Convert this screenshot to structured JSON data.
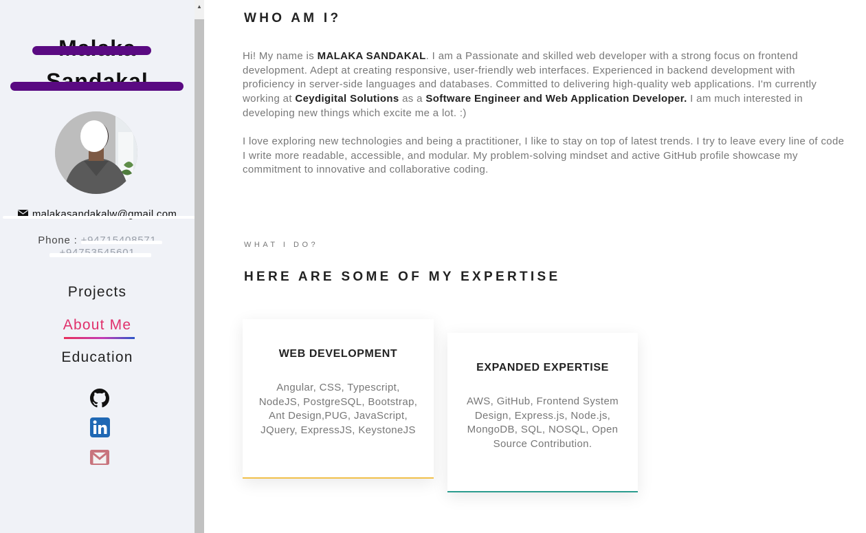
{
  "sidebar": {
    "name_line1": "Malaka",
    "name_line2": "Sandakal",
    "email": "malakasandakalw@gmail.com",
    "phone_label": "Phone :",
    "phone1": "+94715408571",
    "phone2": "+94753545601",
    "nav": {
      "projects": "Projects",
      "about": "About Me",
      "education": "Education"
    },
    "colors": {
      "active_nav": "#e0306b",
      "redaction": "#5a0a82",
      "background": "#f0f2f7"
    }
  },
  "main": {
    "who_title": "WHO AM I?",
    "about": {
      "p1_a": "Hi! My name is ",
      "p1_name": "MALAKA SANDAKAL",
      "p1_b": ". I am a Passionate and skilled web developer with a strong focus on frontend development. Adept at creating responsive, user-friendly web interfaces. Experienced in backend development with proficiency in server-side languages and databases. Committed to delivering high-quality web applications. I'm currently working at ",
      "p1_company": "Ceydigital Solutions",
      "p1_c": " as a ",
      "p1_role": "Software Engineer and Web Application Developer.",
      "p1_d": " I am much interested in developing new things which excite me a lot. :)",
      "p2": "I love exploring new technologies and being a practitioner, I like to stay on top of latest trends. I try to leave every line of code I write more readable, accessible, and modular. My problem-solving mindset and active GitHub profile showcase my commitment to innovative and collaborative coding."
    },
    "what_label": "WHAT I DO?",
    "expertise_title": "HERE ARE SOME OF MY EXPERTISE",
    "cards": [
      {
        "title": "WEB DEVELOPMENT",
        "body": "Angular, CSS, Typescript, NodeJS, PostgreSQL, Bootstrap, Ant Design,PUG, JavaScript, JQuery, ExpressJS, KeystoneJS",
        "accent": "#f1c04a"
      },
      {
        "title": "EXPANDED EXPERTISE",
        "body": "AWS, GitHub, Frontend System Design, Express.js, Node.js, MongoDB, SQL, NOSQL, Open Source Contribution.",
        "accent": "#2a9c8e"
      }
    ]
  },
  "icons": {
    "email": "envelope-icon",
    "github": "github-icon",
    "linkedin": "linkedin-icon",
    "gmail": "gmail-icon",
    "scroll_up": "triangle-up-icon"
  }
}
